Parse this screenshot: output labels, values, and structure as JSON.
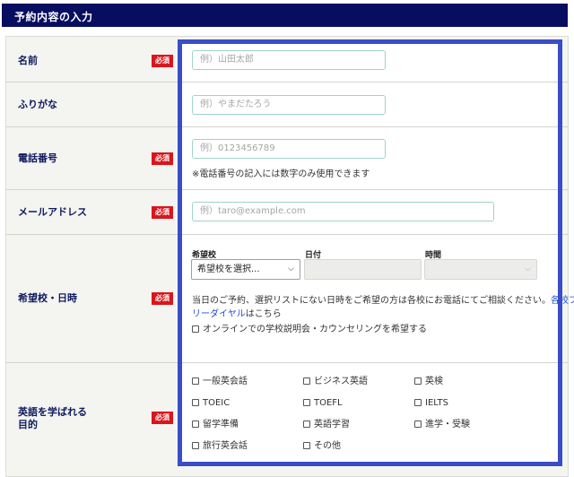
{
  "header": {
    "title": "予約内容の入力"
  },
  "required_badge": "必須",
  "fields": {
    "name": {
      "label": "名前",
      "placeholder": "例）山田太郎"
    },
    "furigana": {
      "label": "ふりがな",
      "placeholder": "例）やまだたろう"
    },
    "phone": {
      "label": "電話番号",
      "placeholder": "例）0123456789",
      "note": "※電話番号の記入には数字のみ使用できます"
    },
    "email": {
      "label": "メールアドレス",
      "placeholder": "例）taro@example.com"
    },
    "school": {
      "label": "希望校・日時",
      "school_label": "希望校",
      "school_select": "希望校を選択...",
      "date_label": "日付",
      "time_label": "時間",
      "note_line1_prefix": "当日のご予約、選択リストにない日時をご希望の方は各校にお電話にてご相談ください。",
      "note_link_part1": "各校フ",
      "note_link_part2": "リーダイヤル",
      "note_line2_suffix": "はこちら",
      "online_option": "オンラインでの学校説明会・カウンセリングを希望する"
    },
    "purpose": {
      "label_line1": "英語を学ばれる",
      "label_line2": "目的",
      "options": [
        "一般英会話",
        "ビジネス英語",
        "英検",
        "TOEIC",
        "TOEFL",
        "IELTS",
        "留学準備",
        "英語学習",
        "進学・受験",
        "旅行英会話",
        "その他"
      ]
    }
  }
}
